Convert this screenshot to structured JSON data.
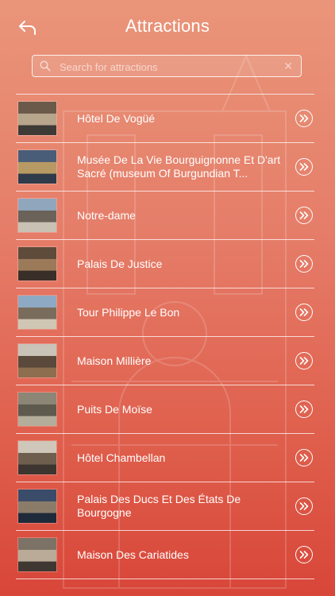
{
  "header": {
    "title": "Attractions",
    "back_icon": "back-arrow-icon"
  },
  "search": {
    "placeholder": "Search for attractions",
    "value": ""
  },
  "attractions": [
    {
      "label": "Hôtel De Vogüé",
      "thumb_colors": [
        "#6b5a4a",
        "#b7a58c",
        "#3e3a36"
      ]
    },
    {
      "label": "Musée De La Vie Bourguignonne Et D'art Sacré (museum Of Burgundian T...",
      "thumb_colors": [
        "#4a5d78",
        "#b79a63",
        "#2f3a4a"
      ]
    },
    {
      "label": "Notre-dame",
      "thumb_colors": [
        "#8fa6bd",
        "#6b625a",
        "#c9c2b4"
      ]
    },
    {
      "label": "Palais De Justice",
      "thumb_colors": [
        "#5e4b3a",
        "#9b7a5a",
        "#3a2f28"
      ]
    },
    {
      "label": "Tour Philippe Le Bon",
      "thumb_colors": [
        "#8ea9c4",
        "#7a6c5c",
        "#cfc6b4"
      ]
    },
    {
      "label": "Maison Millière",
      "thumb_colors": [
        "#c9c3b8",
        "#5b4a3b",
        "#8d6e4f"
      ]
    },
    {
      "label": "Puits De Moïse",
      "thumb_colors": [
        "#8c8676",
        "#5e5a4e",
        "#b4ad9b"
      ]
    },
    {
      "label": "Hôtel Chambellan",
      "thumb_colors": [
        "#cfc7ba",
        "#6e5e4e",
        "#3d3530"
      ]
    },
    {
      "label": "Palais Des Ducs Et Des États De Bourgogne",
      "thumb_colors": [
        "#3a4c6a",
        "#8b7c6a",
        "#1f2a3a"
      ]
    },
    {
      "label": "Maison Des Cariatides",
      "thumb_colors": [
        "#7d7266",
        "#b9ab98",
        "#3f3832"
      ]
    }
  ],
  "colors": {
    "gradient_top": "#E88C6E",
    "gradient_bottom": "#D63C2E",
    "line": "#FFFFFF"
  }
}
